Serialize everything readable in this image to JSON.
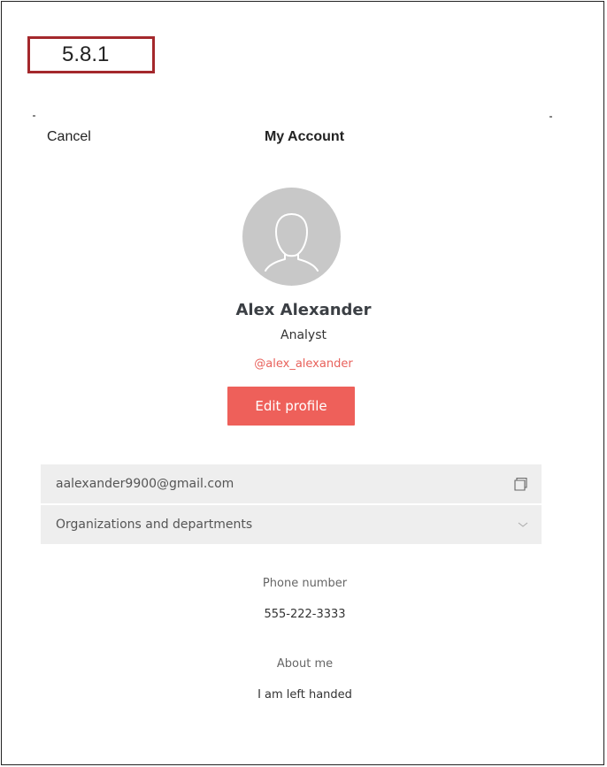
{
  "version_label": "5.8.1",
  "header": {
    "cancel_label": "Cancel",
    "title": "My Account"
  },
  "profile": {
    "avatar_icon": "user-silhouette-icon",
    "name": "Alex Alexander",
    "role": "Analyst",
    "handle": "@alex_alexander",
    "edit_label": "Edit profile"
  },
  "details": {
    "email": "aalexander9900@gmail.com",
    "email_icon": "copy-icon",
    "organizations_label": "Organizations and departments",
    "organizations_icon": "chevron-down-icon"
  },
  "phone": {
    "label": "Phone number",
    "value": "555-222-3333"
  },
  "about": {
    "label": "About me",
    "value": "I am left handed"
  },
  "colors": {
    "accent": "#ee605a",
    "version_border": "#a4282c",
    "row_background": "#eeeeee",
    "avatar_background": "#c8c8c8"
  }
}
